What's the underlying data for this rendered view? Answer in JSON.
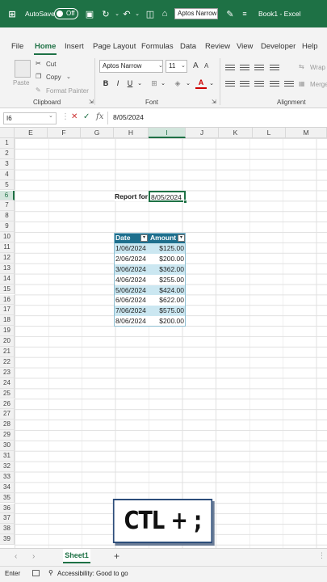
{
  "titlebar": {
    "autosave_label": "AutoSave",
    "toggle_state": "Off",
    "font_name": "Aptos Narrow",
    "workbook_title": "Book1 - Excel"
  },
  "menu": {
    "tabs": [
      "File",
      "Home",
      "Insert",
      "Page Layout",
      "Formulas",
      "Data",
      "Review",
      "View",
      "Developer",
      "Help"
    ],
    "active": "Home"
  },
  "ribbon": {
    "paste": "Paste",
    "cut": "Cut",
    "copy": "Copy",
    "format_painter": "Format Painter",
    "clipboard_group": "Clipboard",
    "font_name": "Aptos Narrow",
    "font_size": "11",
    "font_group": "Font",
    "wrap": "Wrap",
    "merge": "Merge",
    "alignment_group": "Alignment"
  },
  "formula_bar": {
    "name_box": "I6",
    "value": "8/05/2024"
  },
  "columns": [
    "E",
    "F",
    "G",
    "H",
    "I",
    "J",
    "K",
    "L",
    "M"
  ],
  "rows": [
    "1",
    "2",
    "3",
    "4",
    "5",
    "6",
    "7",
    "8",
    "9",
    "10",
    "11",
    "12",
    "13",
    "14",
    "15",
    "16",
    "17",
    "18",
    "19",
    "20",
    "21",
    "22",
    "23",
    "24",
    "25",
    "26",
    "27",
    "28",
    "29",
    "30",
    "31",
    "32",
    "33",
    "34",
    "35",
    "36",
    "37",
    "38",
    "39"
  ],
  "report": {
    "label": "Report for",
    "date_value": "8/05/2024"
  },
  "table": {
    "headers": [
      "Date",
      "Amount"
    ],
    "rows": [
      [
        "1/06/2024",
        "$125.00"
      ],
      [
        "2/06/2024",
        "$200.00"
      ],
      [
        "3/06/2024",
        "$362.00"
      ],
      [
        "4/06/2024",
        "$255.00"
      ],
      [
        "5/06/2024",
        "$424.00"
      ],
      [
        "6/06/2024",
        "$622.00"
      ],
      [
        "7/06/2024",
        "$575.00"
      ],
      [
        "8/06/2024",
        "$200.00"
      ]
    ]
  },
  "overlay_text": "CTL + ;",
  "sheets": {
    "active": "Sheet1",
    "add": "+"
  },
  "status": {
    "mode": "Enter",
    "accessibility": "Accessibility: Good to go"
  },
  "colors": {
    "excel_green": "#1e7145",
    "table_header": "#1e6f8d",
    "table_band": "#cbe7f1"
  }
}
